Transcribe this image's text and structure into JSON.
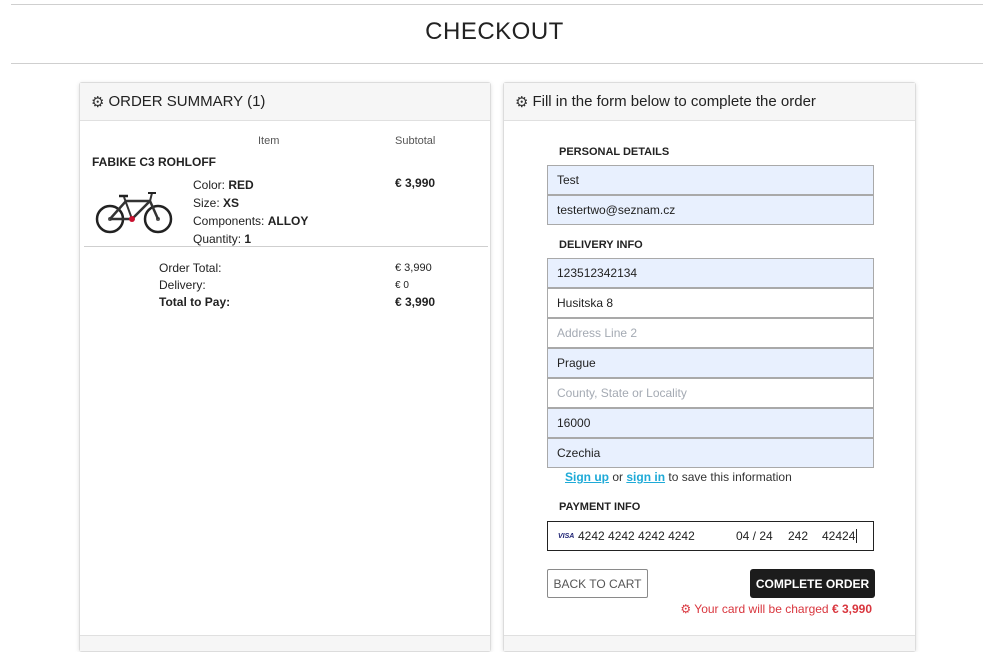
{
  "page": {
    "title": "CHECKOUT"
  },
  "summary": {
    "heading": "ORDER SUMMARY (1)",
    "col_item": "Item",
    "col_subtotal": "Subtotal",
    "item": {
      "name": "FABIKE C3 ROHLOFF",
      "color_label": "Color:",
      "color_value": "RED",
      "size_label": "Size:",
      "size_value": "XS",
      "components_label": "Components:",
      "components_value": "ALLOY",
      "quantity_label": "Quantity:",
      "quantity_value": "1",
      "subtotal": "€ 3,990"
    },
    "order_total_label": "Order Total:",
    "order_total_value": "€ 3,990",
    "delivery_label": "Delivery:",
    "delivery_value": "€ 0",
    "total_label": "Total to Pay:",
    "total_value": "€ 3,990"
  },
  "form": {
    "heading": "Fill in the form below to complete the order",
    "personal_label": "PERSONAL DETAILS",
    "name_value": "Test",
    "email_value": "testertwo@seznam.cz",
    "delivery_label": "DELIVERY INFO",
    "phone_value": "123512342134",
    "address1_value": "Husitska 8",
    "address2_placeholder": "Address Line 2",
    "city_value": "Prague",
    "county_placeholder": "County, State or Locality",
    "zip_value": "16000",
    "country_value": "Czechia",
    "signup_text": "Sign up",
    "or_text": "or",
    "signin_text": "sign in",
    "save_text": "to save this information",
    "payment_label": "PAYMENT INFO",
    "card_brand": "VISA",
    "card_number": "4242 4242 4242 4242",
    "card_expiry": "04 / 24",
    "card_cvc": "242",
    "card_zip": "42424",
    "back_button": "BACK TO CART",
    "complete_button": "COMPLETE ORDER",
    "charge_text": "Your card will be charged",
    "charge_amount": "€ 3,990"
  },
  "colors": {
    "accent_link": "#1eaad7",
    "charge_red": "#d9363e",
    "autofill_bg": "#e8f0fe",
    "dark_button": "#1c1c1c"
  }
}
